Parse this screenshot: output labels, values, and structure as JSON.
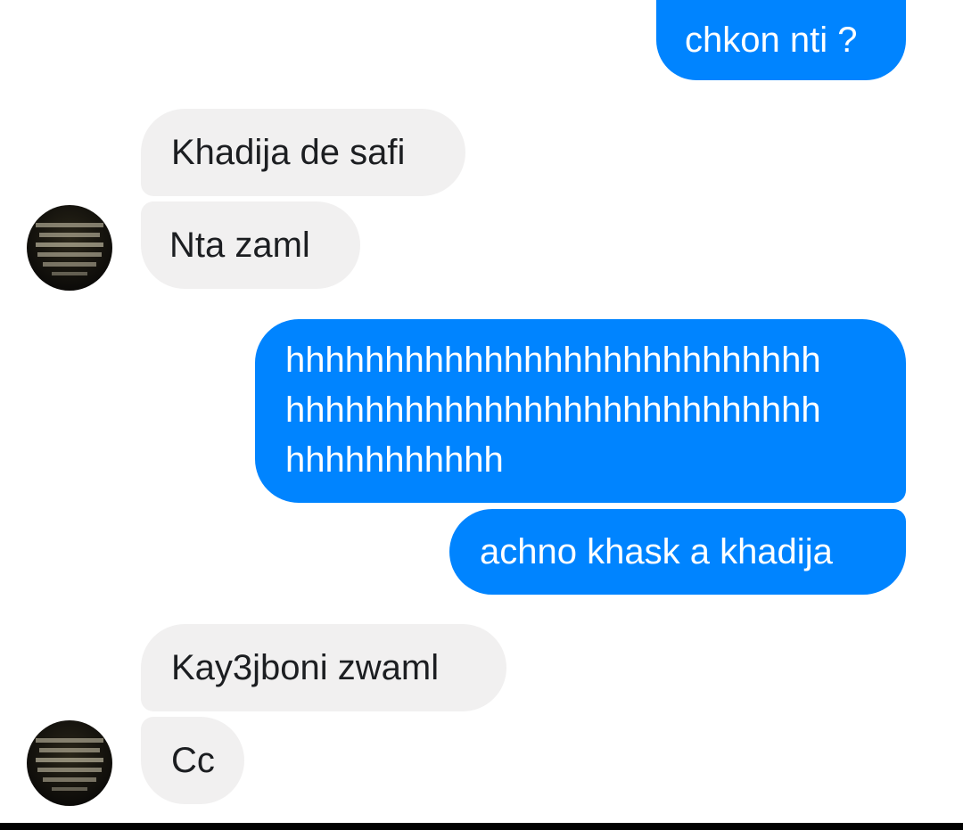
{
  "colors": {
    "sent_bubble": "#0084ff",
    "received_bubble": "#f1f0f0",
    "received_text": "#1c1e21",
    "sent_text": "#ffffff",
    "avatar_background": "#14130f"
  },
  "messages": [
    {
      "direction": "sent",
      "text": "chkon nti ?"
    },
    {
      "direction": "received",
      "text": "Khadija de safi"
    },
    {
      "direction": "received",
      "text": "Nta zaml"
    },
    {
      "direction": "sent",
      "lines": [
        "hhhhhhhhhhhhhhhhhhhhhhhhhhh",
        "hhhhhhhhhhhhhhhhhhhhhhhhhhh",
        "hhhhhhhhhhh"
      ]
    },
    {
      "direction": "sent",
      "text": "achno khask a khadija"
    },
    {
      "direction": "received",
      "text": "Kay3jboni zwaml"
    },
    {
      "direction": "received",
      "text": "Cc"
    }
  ]
}
